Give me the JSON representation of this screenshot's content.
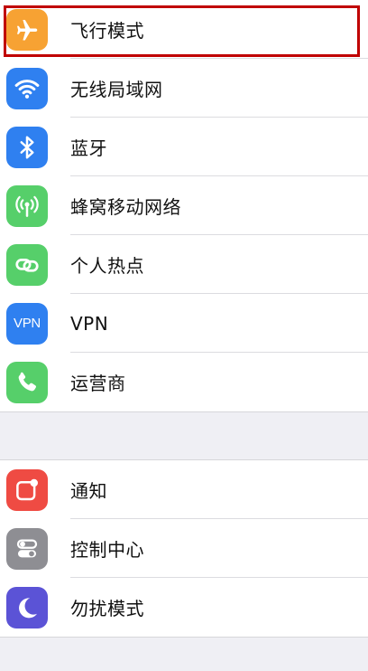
{
  "settings": {
    "group1": [
      {
        "label": "飞行模式",
        "icon": "airplane-icon",
        "color": "#f7a233"
      },
      {
        "label": "无线局域网",
        "icon": "wifi-icon",
        "color": "#2f80f0"
      },
      {
        "label": "蓝牙",
        "icon": "bluetooth-icon",
        "color": "#2f80f0"
      },
      {
        "label": "蜂窝移动网络",
        "icon": "cellular-antenna-icon",
        "color": "#56cf6a"
      },
      {
        "label": "个人热点",
        "icon": "hotspot-link-icon",
        "color": "#56cf6a"
      },
      {
        "label": "VPN",
        "icon": "vpn-icon",
        "icon_text": "VPN",
        "color": "#2f80f0"
      },
      {
        "label": "运营商",
        "icon": "phone-icon",
        "color": "#56cf6a"
      }
    ],
    "group2": [
      {
        "label": "通知",
        "icon": "notification-icon",
        "color": "#ef4b43"
      },
      {
        "label": "控制中心",
        "icon": "control-center-icon",
        "color": "#8e8e93"
      },
      {
        "label": "勿扰模式",
        "icon": "moon-icon",
        "color": "#5b53d6"
      }
    ]
  },
  "highlight": {
    "target": "飞行模式",
    "color": "#c00000"
  }
}
